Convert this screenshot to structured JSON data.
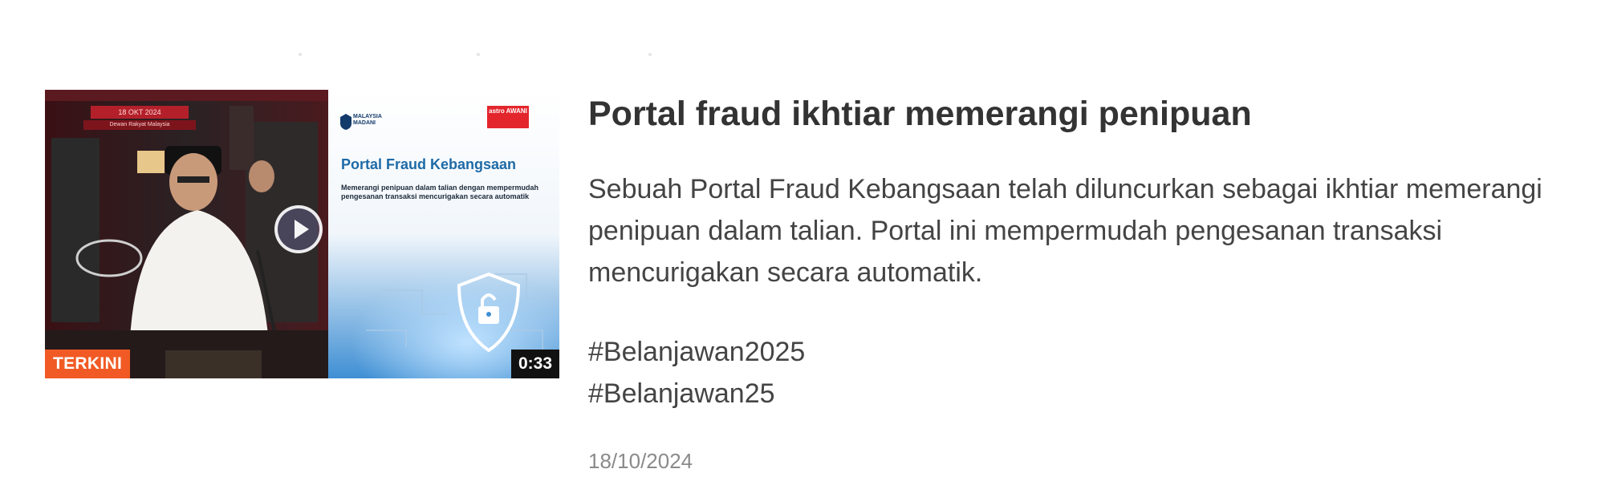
{
  "article": {
    "headline": "Portal fraud ikhtiar memerangi penipuan",
    "summary": "Sebuah Portal Fraud Kebangsaan telah diluncurkan sebagai ikhtiar memerangi penipuan dalam talian. Portal ini mempermudah pengesanan transaksi mencurigakan secara automatik.",
    "hashtags": [
      "#Belanjawan2025",
      "#Belanjawan25"
    ],
    "date": "18/10/2024"
  },
  "thumbnail": {
    "badge": "TERKINI",
    "duration": "0:33",
    "slide_title": "Portal Fraud Kebangsaan",
    "slide_subtitle": "Memerangi penipuan dalam talian dengan mempermudah pengesanan transaksi mencurigakan secara automatik",
    "date_banner": "18 OKT 2024",
    "date_banner_sub": "Dewan Rakyat Malaysia",
    "logo_text": "MALAYSIA MADANI",
    "astro_logo": "astro AWANI",
    "icons": {
      "play": "play-icon",
      "lock": "lock-shield-icon"
    }
  },
  "colors": {
    "badge_orange": "#f15a24",
    "headline": "#333333",
    "body": "#444444",
    "date": "#8a8a8a",
    "slide_blue": "#1e6aa6"
  }
}
